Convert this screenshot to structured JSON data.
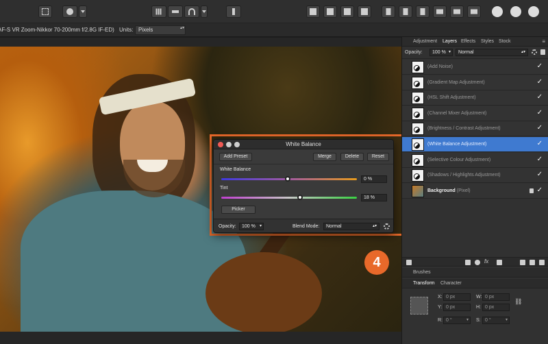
{
  "context_bar": {
    "lens_text": "AF-S VR Zoom-Nikkor 70-200mm f/2.8G IF-ED)",
    "units_label": "Units:",
    "units_value": "Pixels"
  },
  "white_balance_panel": {
    "title": "White Balance",
    "add_preset_label": "Add Preset",
    "merge_label": "Merge",
    "delete_label": "Delete",
    "reset_label": "Reset",
    "white_balance_label": "White Balance",
    "white_balance_value": "0 %",
    "white_balance_level": 0,
    "tint_label": "Tint",
    "tint_value": "18 %",
    "tint_level": 18,
    "picker_label": "Picker",
    "opacity_label": "Opacity:",
    "opacity_value": "100 %",
    "blend_mode_label": "Blend Mode:",
    "blend_mode_value": "Normal",
    "accent_color": "#e8692a"
  },
  "step_badge": "4",
  "right_panel": {
    "tabs": [
      "Adjustment",
      "Layers",
      "Effects",
      "Styles",
      "Stock"
    ],
    "active_tab": "Layers",
    "opacity_label": "Opacity:",
    "opacity_value": "100 %",
    "blend_value": "Normal",
    "layers": [
      {
        "name": "(Add Noise)",
        "checked": true
      },
      {
        "name": "(Gradient Map Adjustment)",
        "checked": true
      },
      {
        "name": "(HSL Shift Adjustment)",
        "checked": true
      },
      {
        "name": "(Channel Mixer Adjustment)",
        "checked": true
      },
      {
        "name": "(Brightness / Contrast Adjustment)",
        "checked": true
      },
      {
        "name": "(White Balance Adjustment)",
        "checked": true,
        "selected": true
      },
      {
        "name": "(Selective Colour Adjustment)",
        "checked": true
      },
      {
        "name": "(Shadows / Highlights Adjustment)",
        "checked": true
      }
    ],
    "background_layer": {
      "name": "Background",
      "type": "(Pixel)",
      "locked": true,
      "checked": true
    },
    "brushes_label": "Brushes",
    "transform_tab": "Transform",
    "character_tab": "Character",
    "transform": {
      "x_label": "X:",
      "x_value": "0 px",
      "y_label": "Y:",
      "y_value": "0 px",
      "w_label": "W:",
      "w_value": "0 px",
      "h_label": "H:",
      "h_value": "0 px",
      "r_label": "R:",
      "r_value": "0 °",
      "s_label": "S:",
      "s_value": "0 °"
    },
    "selection_color": "#3f7ad0"
  }
}
